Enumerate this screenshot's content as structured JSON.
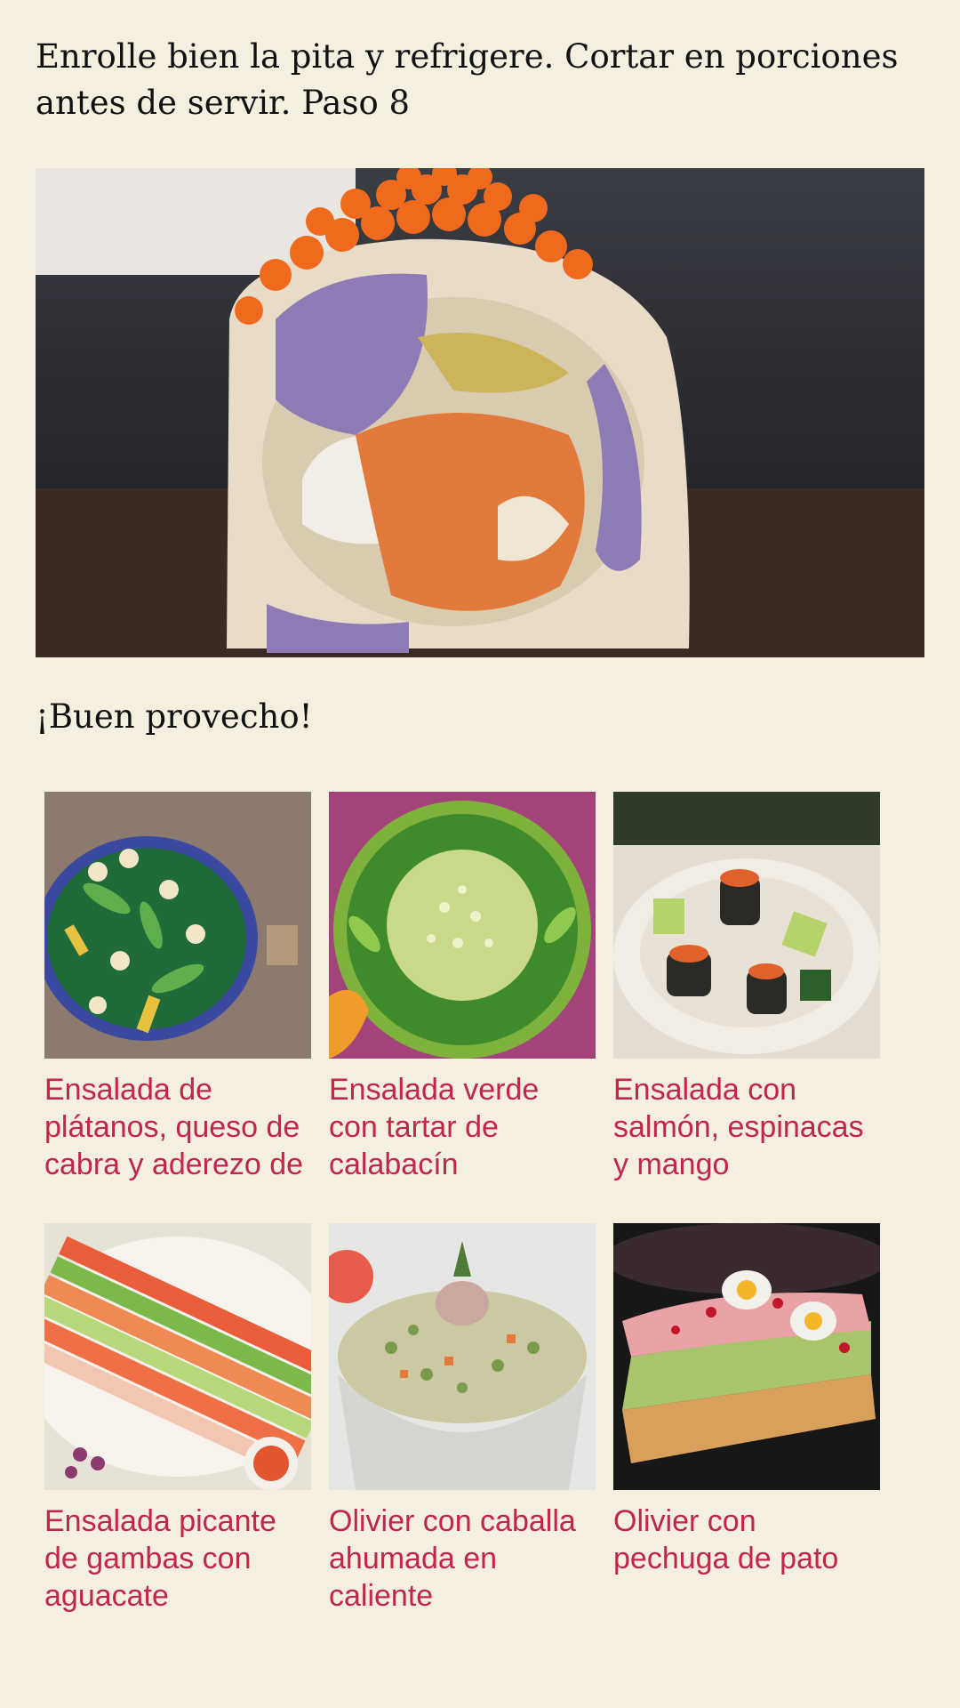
{
  "step": {
    "text": "Enrolle bien la pita y refrigere. Cortar en porciones antes de servir. Paso 8"
  },
  "closing": {
    "text": "¡Buen provecho!"
  },
  "related": [
    {
      "title": "Ensalada de plátanos, queso de cabra y aderezo de"
    },
    {
      "title": "Ensalada verde con tartar de calabacín"
    },
    {
      "title": "Ensalada con salmón, espinacas y mango"
    },
    {
      "title": "Ensalada picante de gambas con aguacate"
    },
    {
      "title": "Olivier con caballa ahumada en caliente"
    },
    {
      "title": "Olivier con pechuga de pato"
    }
  ],
  "colors": {
    "background": "#f5efe0",
    "link": "#c2254e",
    "text": "#111111"
  }
}
